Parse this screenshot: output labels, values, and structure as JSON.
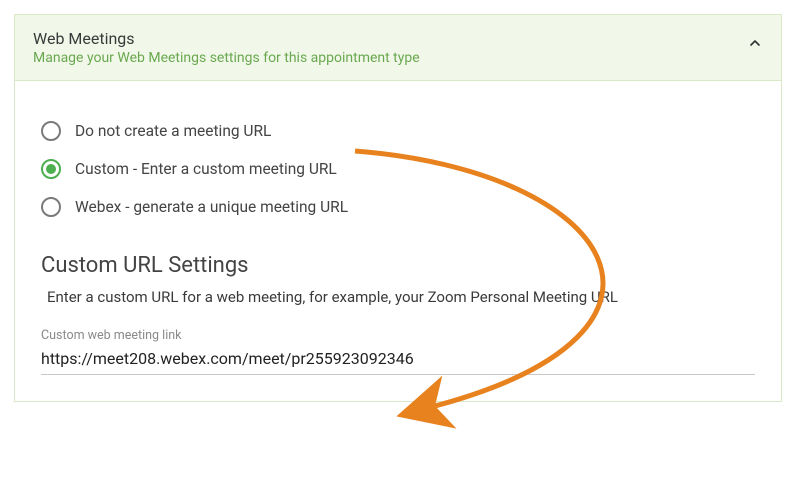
{
  "header": {
    "title": "Web Meetings",
    "subtitle": "Manage your Web Meetings settings for this appointment type"
  },
  "options": [
    {
      "label": "Do not create a meeting URL",
      "selected": false
    },
    {
      "label": "Custom - Enter a custom meeting URL",
      "selected": true
    },
    {
      "label": "Webex - generate a unique meeting URL",
      "selected": false
    }
  ],
  "customSection": {
    "title": "Custom URL Settings",
    "description": "Enter a custom URL for a web meeting, for example, your Zoom Personal Meeting URL",
    "fieldLabel": "Custom web meeting link",
    "value": "https://meet208.webex.com/meet/pr255923092346"
  }
}
